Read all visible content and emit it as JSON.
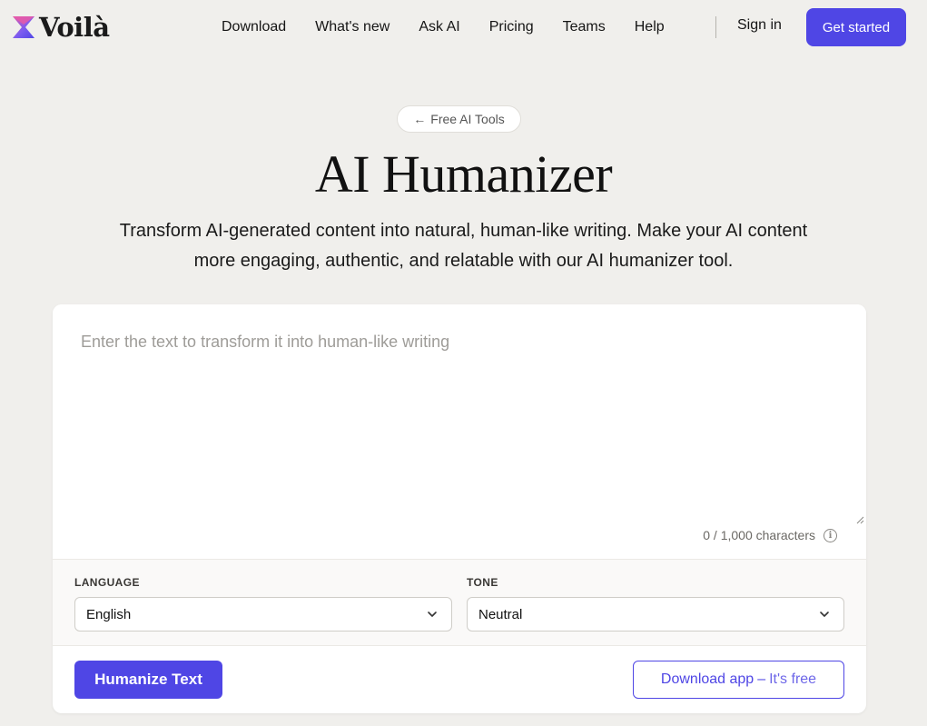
{
  "brand": {
    "name": "Voilà",
    "logo_colors": [
      "#e65aa8",
      "#7c5cf0",
      "#4f46e5"
    ]
  },
  "nav": {
    "items": [
      "Download",
      "What's new",
      "Ask AI",
      "Pricing",
      "Teams",
      "Help"
    ],
    "sign_in": "Sign in",
    "get_started": "Get started"
  },
  "hero": {
    "back_chip": "Free AI Tools",
    "back_icon": "arrow-left-icon",
    "title": "AI Humanizer",
    "subtitle": "Transform AI-generated content into natural, human-like writing. Make your AI content more engaging, authentic, and relatable with our AI humanizer tool."
  },
  "editor": {
    "value": "",
    "placeholder": "Enter the text to transform it into human-like writing",
    "char_count": "0 / 1,000 characters",
    "info_icon": "info-icon"
  },
  "options": {
    "language_label": "LANGUAGE",
    "language_value": "English",
    "tone_label": "TONE",
    "tone_value": "Neutral"
  },
  "actions": {
    "humanize": "Humanize Text",
    "download_main": "Download app",
    "download_sep": "–",
    "download_free": "It's free"
  },
  "colors": {
    "accent": "#4f46e5",
    "background": "#f0efec",
    "card": "#ffffff"
  }
}
